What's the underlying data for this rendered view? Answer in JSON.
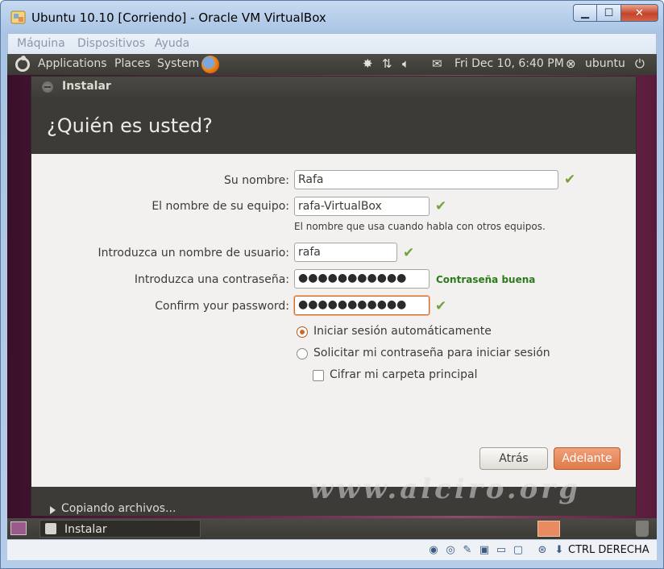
{
  "window": {
    "title": "Ubuntu 10.10 [Corriendo] - Oracle VM VirtualBox",
    "minimize_glyph": "▁",
    "maximize_glyph": "☐",
    "close_glyph": "✕"
  },
  "vbox_menu": [
    "Máquina",
    "Dispositivos",
    "Ayuda"
  ],
  "gnome_panel": {
    "menus": [
      "Applications",
      "Places",
      "System"
    ],
    "clock": "Fri Dec 10,  6:40 PM",
    "user": "ubuntu",
    "icons": [
      "bug-icon",
      "network-icon",
      "volume-icon",
      "mail-icon",
      "user-icon",
      "power-icon"
    ]
  },
  "installer": {
    "window_title": "Instalar",
    "heading": "¿Quién es usted?",
    "fields": {
      "name": {
        "label": "Su nombre:",
        "value": "Rafa"
      },
      "computer": {
        "label": "El nombre de su equipo:",
        "value": "rafa-VirtualBox",
        "hint": "El nombre que usa cuando habla con otros equipos."
      },
      "username": {
        "label": "Introduzca un nombre de usuario:",
        "value": "rafa"
      },
      "password": {
        "label": "Introduzca una contraseña:",
        "value": "●●●●●●●●●●●",
        "strength": "Contraseña buena"
      },
      "confirm": {
        "label": "Confirm your password:",
        "value": "●●●●●●●●●●●"
      }
    },
    "options": {
      "auto_login": "Iniciar sesión automáticamente",
      "require_password": "Solicitar mi contraseña para iniciar sesión",
      "encrypt_home": "Cifrar mi carpeta principal"
    },
    "buttons": {
      "back": "Atrás",
      "next": "Adelante"
    },
    "progress": "Copiando archivos...",
    "watermark": "www.alciro.org"
  },
  "taskbar": {
    "task_label": "Instalar"
  },
  "vbox_status": {
    "host_key": "CTRL DERECHA"
  },
  "colors": {
    "accent": "#e07a49",
    "ok_green": "#74a23c",
    "dark": "#3c3b37"
  }
}
